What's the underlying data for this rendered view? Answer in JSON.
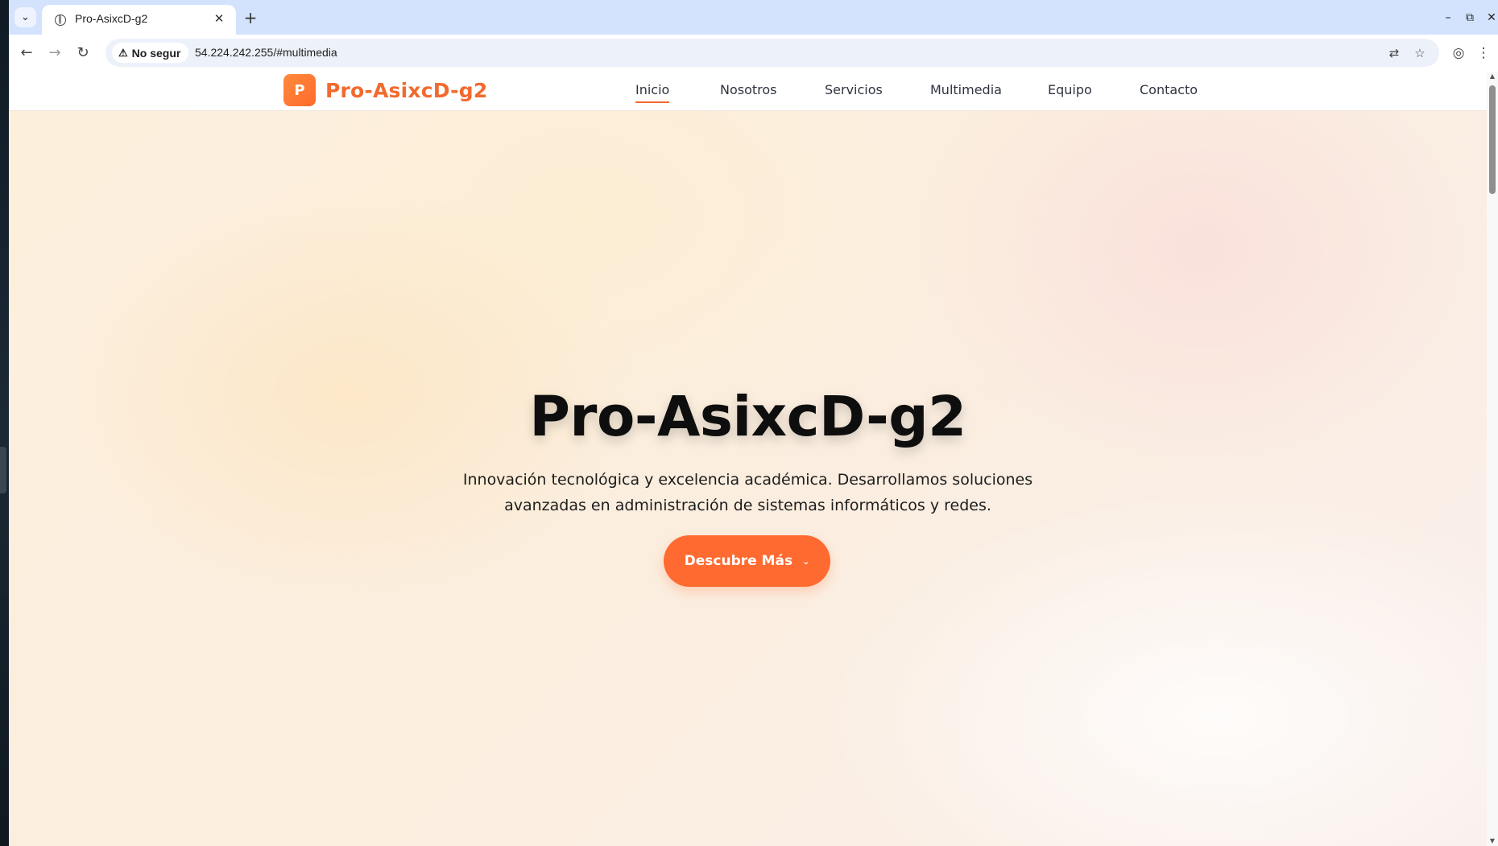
{
  "browser": {
    "tab": {
      "title": "Pro-AsixcD-g2"
    },
    "security_label": "No segur",
    "url": "54.224.242.255/#multimedia"
  },
  "site": {
    "logo_letter": "P",
    "brand_name": "Pro-AsixcD-g2",
    "nav": [
      {
        "label": "Inicio",
        "active": true
      },
      {
        "label": "Nosotros"
      },
      {
        "label": "Servicios"
      },
      {
        "label": "Multimedia"
      },
      {
        "label": "Equipo"
      },
      {
        "label": "Contacto"
      }
    ]
  },
  "hero": {
    "title": "Pro-AsixcD-g2",
    "subtitle": "Innovación tecnológica y excelencia académica. Desarrollamos soluciones avanzadas en administración de sistemas informáticos y redes.",
    "cta_label": "Descubre Más"
  },
  "colors": {
    "accent": "#f26a2e",
    "cta": "#ff6a30",
    "tabstrip": "#d3e3fd"
  },
  "icons": {
    "tab_search": "chevron-down-icon",
    "favicon": "globe-icon",
    "translate": "translate-icon",
    "bookmark": "star-icon",
    "profile": "account-icon",
    "menu": "kebab-menu-icon"
  }
}
